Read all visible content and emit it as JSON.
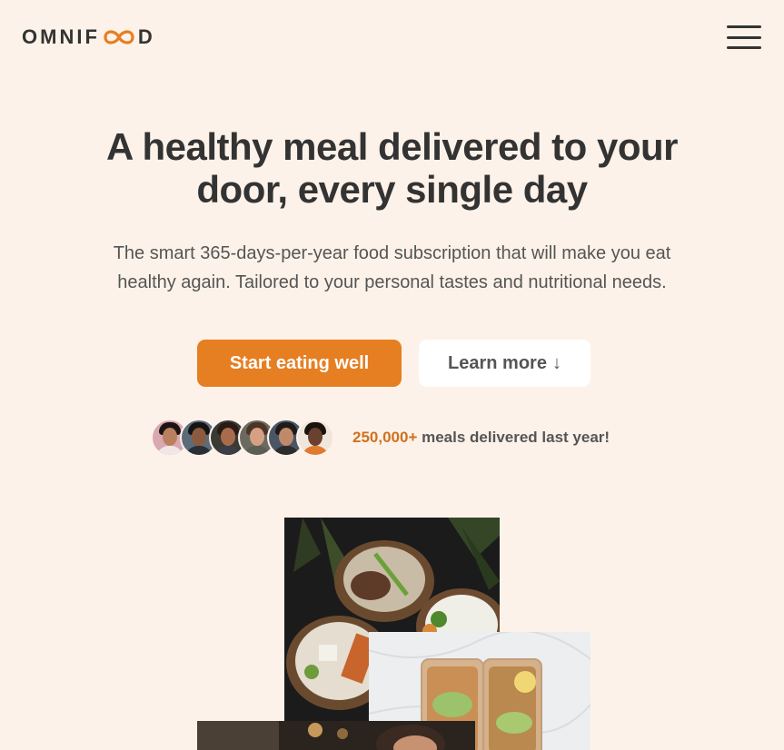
{
  "header": {
    "logo_text_before": "OMNIF",
    "logo_text_after": "D",
    "logo_icon": "infinity-icon",
    "menu_icon": "hamburger-menu-icon"
  },
  "hero": {
    "title_line1": "A healthy meal delivered to your",
    "title_line2": "door, every single day",
    "description_line1": "The smart 365-days-per-year food subscription that will make you eat",
    "description_line2": "healthy again. Tailored to your personal tastes and nutritional needs.",
    "primary_button": "Start eating well",
    "secondary_button": "Learn more",
    "secondary_button_arrow": "↓"
  },
  "delivered": {
    "highlight": "250,000+",
    "text": " meals delivered last year!"
  },
  "colors": {
    "background": "#fdf2e9",
    "accent": "#e67e22",
    "accent_text": "#cf711f",
    "text": "#333333"
  }
}
